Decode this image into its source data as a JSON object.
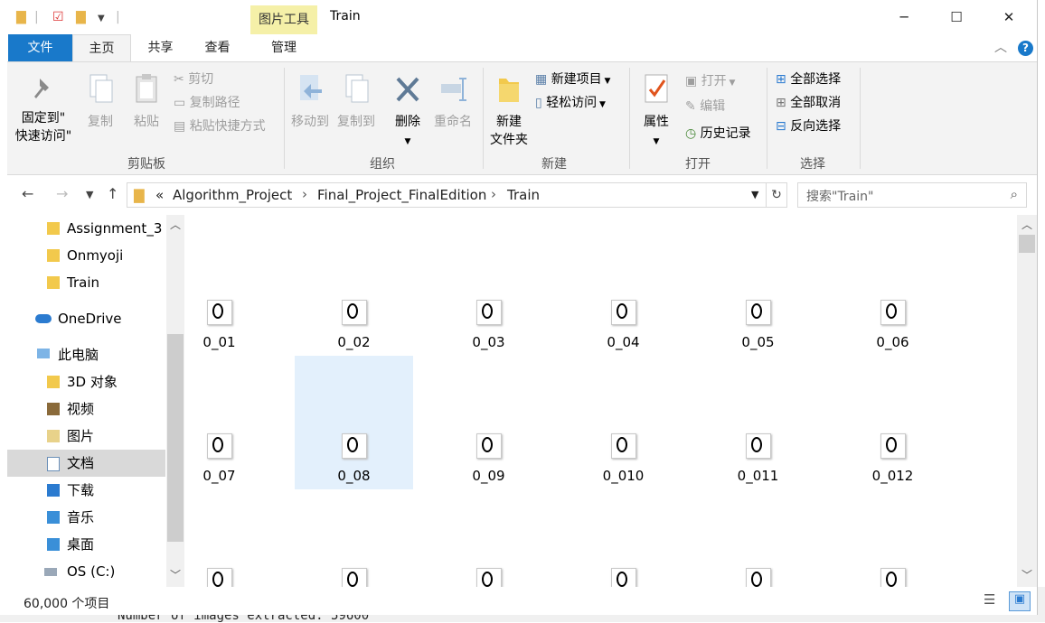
{
  "title": "Train",
  "context_tab": "图片工具",
  "tabs": {
    "file": "文件",
    "home": "主页",
    "share": "共享",
    "view": "查看",
    "manage": "管理"
  },
  "ribbon": {
    "clipboard": {
      "label": "剪贴板",
      "pin_line1": "固定到\"",
      "pin_line2": "快速访问\"",
      "copy": "复制",
      "paste": "粘贴",
      "cut": "剪切",
      "copy_path": "复制路径",
      "paste_shortcut": "粘贴快捷方式"
    },
    "organize": {
      "label": "组织",
      "move_to": "移动到",
      "copy_to": "复制到",
      "delete": "删除",
      "rename": "重命名"
    },
    "new": {
      "label": "新建",
      "new_folder_line1": "新建",
      "new_folder_line2": "文件夹",
      "new_item": "新建项目",
      "easy_access": "轻松访问"
    },
    "open": {
      "label": "打开",
      "properties": "属性",
      "open": "打开",
      "edit": "编辑",
      "history": "历史记录"
    },
    "select": {
      "label": "选择",
      "select_all": "全部选择",
      "select_none": "全部取消",
      "invert": "反向选择"
    }
  },
  "address": {
    "overflow": "«",
    "crumbs": [
      "Algorithm_Project",
      "Final_Project_FinalEdition",
      "Train"
    ],
    "search_placeholder": "搜索\"Train\""
  },
  "nav": {
    "items": [
      {
        "label": "Assignment_3",
        "icon": "folder-icon"
      },
      {
        "label": "Onmyoji",
        "icon": "folder-icon"
      },
      {
        "label": "Train",
        "icon": "folder-icon"
      },
      {
        "label": "OneDrive",
        "icon": "cloud-icon"
      },
      {
        "label": "此电脑",
        "icon": "computer-icon"
      },
      {
        "label": "3D 对象",
        "icon": "3d-objects-icon"
      },
      {
        "label": "视频",
        "icon": "video-folder-icon"
      },
      {
        "label": "图片",
        "icon": "pictures-folder-icon"
      },
      {
        "label": "文档",
        "icon": "documents-folder-icon"
      },
      {
        "label": "下载",
        "icon": "downloads-folder-icon"
      },
      {
        "label": "音乐",
        "icon": "music-folder-icon"
      },
      {
        "label": "桌面",
        "icon": "desktop-folder-icon"
      },
      {
        "label": "OS (C:)",
        "icon": "drive-icon"
      }
    ],
    "selected": "文档"
  },
  "files": {
    "row1": [
      "0_01",
      "0_02",
      "0_03",
      "0_04",
      "0_05",
      "0_06"
    ],
    "row2": [
      "0_07",
      "0_08",
      "0_09",
      "0_010",
      "0_011",
      "0_012"
    ],
    "selected": "0_08"
  },
  "status": {
    "count": "60,000 个项目"
  },
  "background": {
    "console_text": "Number of images extracted: 59600"
  },
  "colors": {
    "accent": "#1979ca",
    "picture_tools": "#f5f0a8",
    "selection": "#e3f0fc"
  }
}
